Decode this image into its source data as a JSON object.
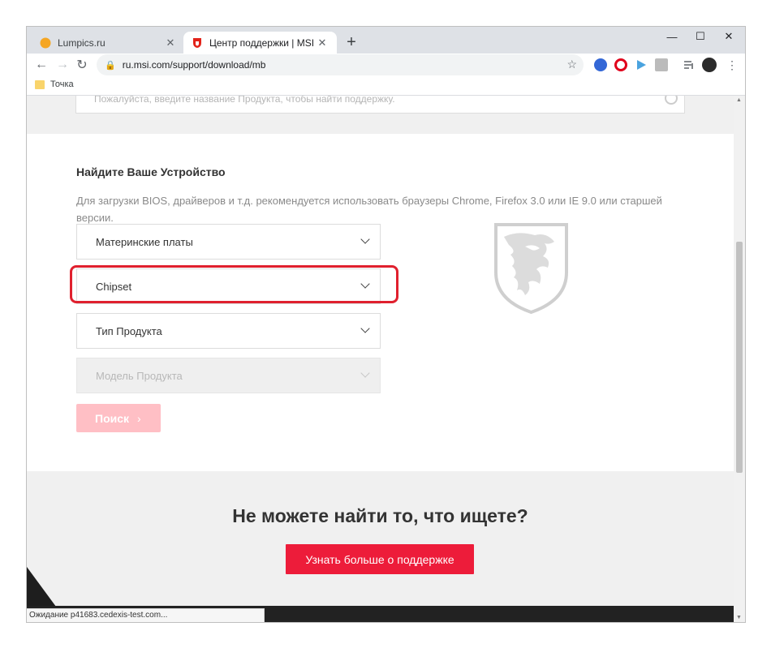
{
  "browser": {
    "tabs": [
      {
        "title": "Lumpics.ru",
        "close": "✕"
      },
      {
        "title": "Центр поддержки | MSI Россия",
        "close": "✕"
      }
    ],
    "new_tab": "+",
    "window_controls": {
      "minimize": "—",
      "maximize": "☐",
      "close": "✕"
    },
    "nav": {
      "back": "←",
      "forward": "→",
      "reload": "↻"
    },
    "address": "ru.msi.com/support/download/mb",
    "bookmarks": [
      {
        "label": "Точка"
      }
    ]
  },
  "page": {
    "search_placeholder": "Пожалуйста, введите название Продукта, чтобы найти поддержку.",
    "find_title": "Найдите Ваше Устройство",
    "find_desc": "Для загрузки BIOS, драйверов и т.д. рекомендуется использовать браузеры Chrome, Firefox 3.0 или IE 9.0 или старшей версии.",
    "selects": [
      {
        "value": "Материнские платы"
      },
      {
        "value": "Chipset"
      },
      {
        "value": "Тип Продукта"
      },
      {
        "value": "Модель Продукта",
        "disabled": true
      }
    ],
    "search_button": "Поиск",
    "search_button_arrow": "›",
    "cant_find_title": "Не можете найти то, что ищете?",
    "support_button": "Узнать больше о поддержке"
  },
  "status_text": "Ожидание p41683.cedexis-test.com...",
  "colors": {
    "accent": "#ed1c3a",
    "highlight": "#e0202e",
    "search_disabled": "#ffbfc5"
  }
}
